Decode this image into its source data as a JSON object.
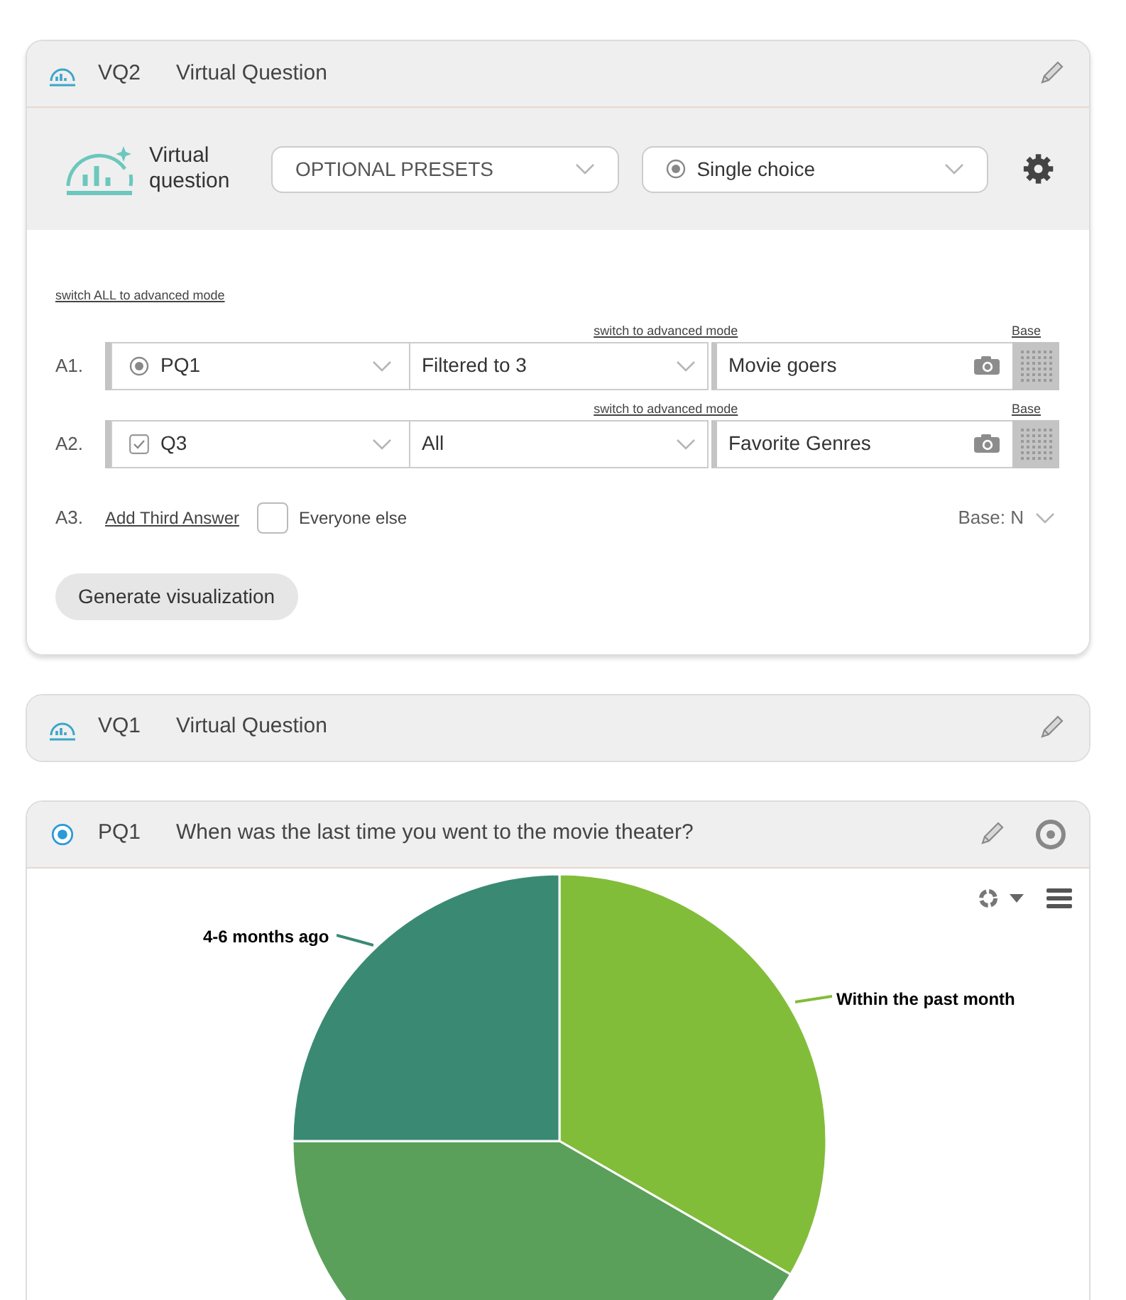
{
  "cards": [
    {
      "kind": "virtual",
      "code": "VQ2",
      "title": "Virtual Question",
      "editor": {
        "logo_text": "Virtual question",
        "presets": "OPTIONAL PRESETS",
        "type": "Single choice",
        "switch_all": "switch ALL to advanced mode",
        "answers": [
          {
            "label": "A1.",
            "switch": "switch to advanced mode",
            "base_link": "Base",
            "kind": "radio",
            "question": "PQ1",
            "filter": "Filtered to 3",
            "name": "Movie goers"
          },
          {
            "label": "A2.",
            "switch": "switch to advanced mode",
            "base_link": "Base",
            "kind": "checkbox",
            "question": "Q3",
            "filter": "All",
            "name": "Favorite Genres"
          }
        ],
        "third": {
          "label": "A3.",
          "link": "Add Third Answer",
          "checked": false,
          "option": "Everyone else",
          "base": "Base: N"
        },
        "button": "Generate visualization"
      }
    },
    {
      "kind": "virtual",
      "code": "VQ1",
      "title": "Virtual Question"
    },
    {
      "kind": "single",
      "code": "PQ1",
      "title": "When was the last time you went to the movie theater?",
      "chart": {
        "slice_labels": [
          "4-6 months ago",
          "Within the past month"
        ]
      }
    }
  ]
}
